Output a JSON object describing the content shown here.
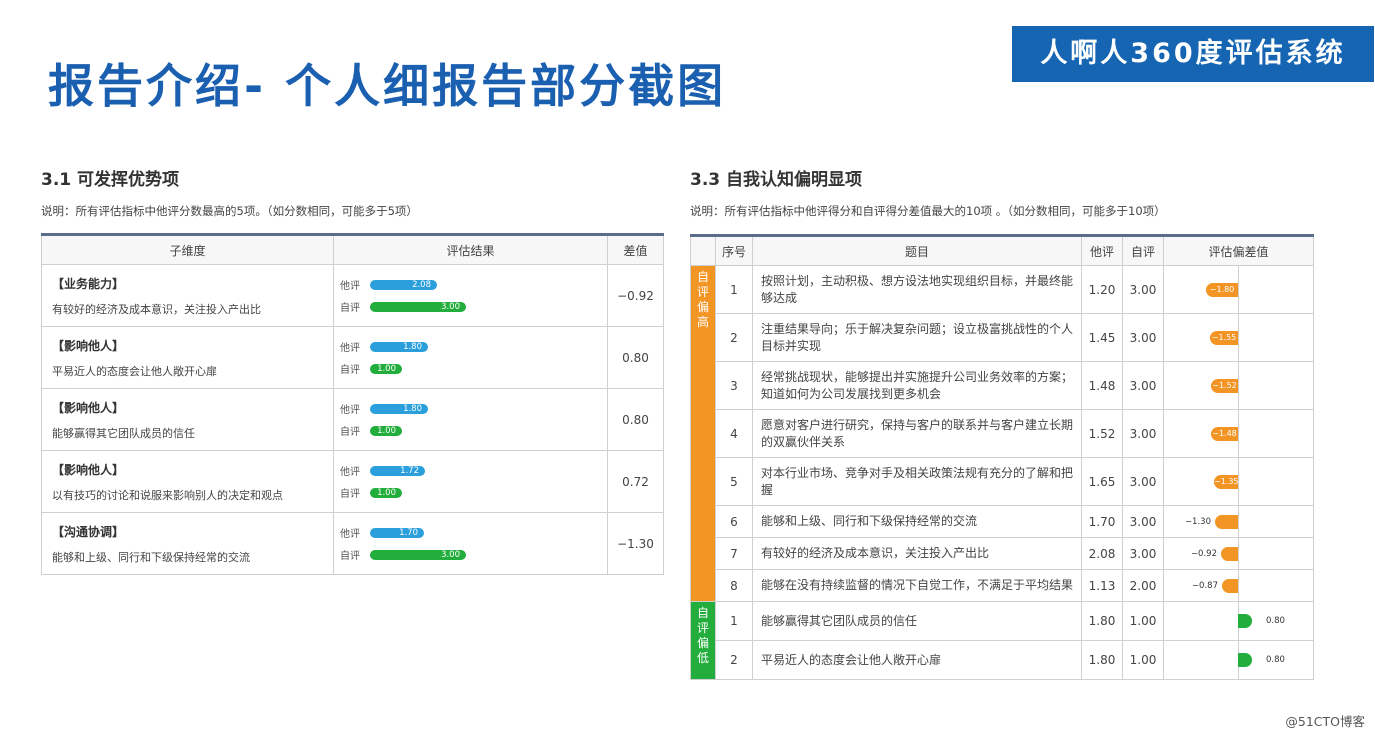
{
  "header": {
    "title": "报告介绍- 个人细报告部分截图",
    "brand": "人啊人360度评估系统"
  },
  "colors": {
    "brand_blue": "#1565b3",
    "title_blue": "#1a5fb0",
    "other_bar": "#2b9fdb",
    "self_bar": "#22ad3c",
    "gap_high": "#f39525",
    "gap_low": "#22ad3c"
  },
  "left": {
    "title": "3.1 可发挥优势项",
    "note": "说明：所有评估指标中他评分数最高的5项。（如分数相同，可能多于5项）",
    "headers": [
      "子维度",
      "评估结果",
      "差值"
    ],
    "other_label": "他评",
    "self_label": "自评",
    "rows": [
      {
        "name": "【业务能力】",
        "desc": "有较好的经济及成本意识，关注投入产出比",
        "other": "2.08",
        "self": "3.00",
        "diff": "−0.92"
      },
      {
        "name": "【影响他人】",
        "desc": "平易近人的态度会让他人敞开心扉",
        "other": "1.80",
        "self": "1.00",
        "diff": "0.80"
      },
      {
        "name": "【影响他人】",
        "desc": "能够赢得其它团队成员的信任",
        "other": "1.80",
        "self": "1.00",
        "diff": "0.80"
      },
      {
        "name": "【影响他人】",
        "desc": "以有技巧的讨论和说服来影响别人的决定和观点",
        "other": "1.72",
        "self": "1.00",
        "diff": "0.72"
      },
      {
        "name": "【沟通协调】",
        "desc": "能够和上级、同行和下级保持经常的交流",
        "other": "1.70",
        "self": "3.00",
        "diff": "−1.30"
      }
    ]
  },
  "right": {
    "title": "3.3 自我认知偏明显项",
    "note": "说明：所有评估指标中他评得分和自评得分差值最大的10项 。（如分数相同，可能多于10项）",
    "headers": [
      "序号",
      "题目",
      "他评",
      "自评",
      "评估偏差值"
    ],
    "group_high": "自评偏高",
    "group_low": "自评偏低",
    "rows": [
      {
        "idx": "1",
        "item": "按照计划，主动积极、想方设法地实现组织目标，并最终能够达成",
        "other": "1.20",
        "self": "3.00",
        "gap": "−1.80",
        "gap_value": -1.8
      },
      {
        "idx": "2",
        "item": "注重结果导向；乐于解决复杂问题；设立极富挑战性的个人目标并实现",
        "other": "1.45",
        "self": "3.00",
        "gap": "−1.55",
        "gap_value": -1.55
      },
      {
        "idx": "3",
        "item": "经常挑战现状，能够提出并实施提升公司业务效率的方案；知道如何为公司发展找到更多机会",
        "other": "1.48",
        "self": "3.00",
        "gap": "−1.52",
        "gap_value": -1.52
      },
      {
        "idx": "4",
        "item": "愿意对客户进行研究，保持与客户的联系并与客户建立长期的双赢伙伴关系",
        "other": "1.52",
        "self": "3.00",
        "gap": "−1.48",
        "gap_value": -1.48
      },
      {
        "idx": "5",
        "item": "对本行业市场、竞争对手及相关政策法规有充分的了解和把握",
        "other": "1.65",
        "self": "3.00",
        "gap": "−1.35",
        "gap_value": -1.35
      },
      {
        "idx": "6",
        "item": "能够和上级、同行和下级保持经常的交流",
        "other": "1.70",
        "self": "3.00",
        "gap": "−1.30",
        "gap_value": -1.3
      },
      {
        "idx": "7",
        "item": "有较好的经济及成本意识，关注投入产出比",
        "other": "2.08",
        "self": "3.00",
        "gap": "−0.92",
        "gap_value": -0.92
      },
      {
        "idx": "8",
        "item": "能够在没有持续监督的情况下自觉工作，不满足于平均结果",
        "other": "1.13",
        "self": "2.00",
        "gap": "−0.87",
        "gap_value": -0.87
      },
      {
        "idx": "1",
        "item": "能够赢得其它团队成员的信任",
        "other": "1.80",
        "self": "1.00",
        "gap": "0.80",
        "gap_value": 0.8
      },
      {
        "idx": "2",
        "item": "平易近人的态度会让他人敞开心扉",
        "other": "1.80",
        "self": "1.00",
        "gap": "0.80",
        "gap_value": 0.8
      }
    ]
  },
  "watermark": "@51CTO博客"
}
